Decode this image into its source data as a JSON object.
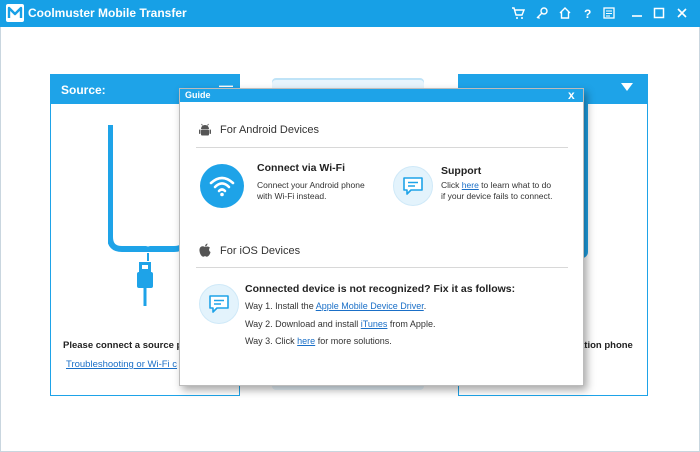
{
  "app": {
    "title": "Coolmuster Mobile Transfer",
    "logo_letter": "M"
  },
  "titlebar_icons": [
    "cart-icon",
    "key-icon",
    "home-icon",
    "help-icon",
    "feedback-icon",
    "minimize-icon",
    "maximize-icon",
    "close-icon"
  ],
  "source_panel": {
    "title": "Source:",
    "minimize_label": "—",
    "caption": "Please connect a source ph",
    "link": "Troubleshooting or Wi-Fi c"
  },
  "destination_panel": {
    "caption": "ation phone"
  },
  "dialog": {
    "title": "Guide",
    "close_label": "x",
    "android": {
      "heading": "For Android Devices",
      "wifi_title": "Connect via Wi-Fi",
      "wifi_desc_1": "Connect your Android phone",
      "wifi_desc_2": "with Wi-Fi instead.",
      "support_title": "Support",
      "support_pre": "Click ",
      "support_link": "here",
      "support_post": " to learn what to do",
      "support_line2": "if your device fails to connect."
    },
    "ios": {
      "heading": "For iOS Devices",
      "fix_title": "Connected device is not recognized? Fix it as follows:",
      "way1_pre": "Way 1. Install the ",
      "way1_link": "Apple Mobile Device Driver",
      "way1_post": ".",
      "way2_pre": "Way 2. Download and install ",
      "way2_link": "iTunes",
      "way2_post": " from Apple.",
      "way3_pre": "Way 3. Click ",
      "way3_link": "here",
      "way3_post": " for more solutions."
    }
  },
  "colors": {
    "accent": "#1ea3e8",
    "titlebar": "#17a0e6",
    "link": "#1a6fc7"
  }
}
